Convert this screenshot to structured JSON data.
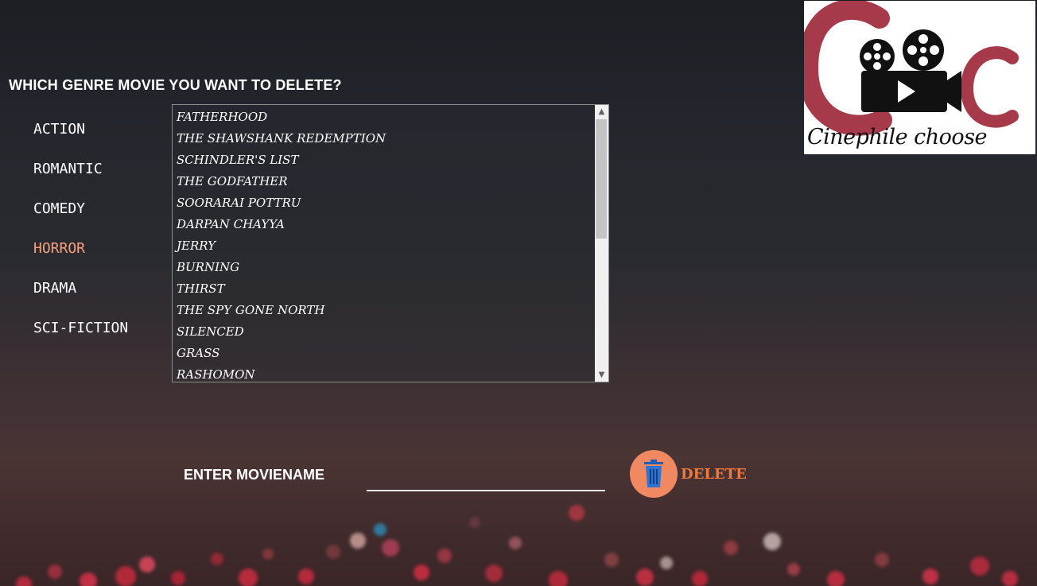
{
  "header": {
    "question": "WHICH GENRE MOVIE YOU WANT TO DELETE?"
  },
  "genres": [
    {
      "label": "ACTION"
    },
    {
      "label": "ROMANTIC"
    },
    {
      "label": "COMEDY"
    },
    {
      "label": "HORROR",
      "active": true
    },
    {
      "label": "DRAMA"
    },
    {
      "label": "SCI-FICTION"
    }
  ],
  "movies": [
    "FATHERHOOD",
    "THE SHAWSHANK REDEMPTION",
    "SCHINDLER'S LIST",
    "THE GODFATHER",
    "SOORARAI POTTRU",
    "DARPAN CHAYYA",
    "JERRY",
    "BURNING",
    "THIRST",
    "THE SPY GONE NORTH",
    "SILENCED",
    "GRASS",
    "RASHOMON"
  ],
  "logo": {
    "text": "Cinephile choose",
    "icon": "film-camera-icon"
  },
  "form": {
    "enter_label": "ENTER MOVIENAME",
    "input_value": "",
    "delete_label": "DELETE",
    "delete_icon": "trash-icon"
  },
  "colors": {
    "accent": "#f4a07a",
    "delete_circle": "#f08862",
    "delete_text": "#f07a3a",
    "logo_red": "#a63a4a"
  }
}
